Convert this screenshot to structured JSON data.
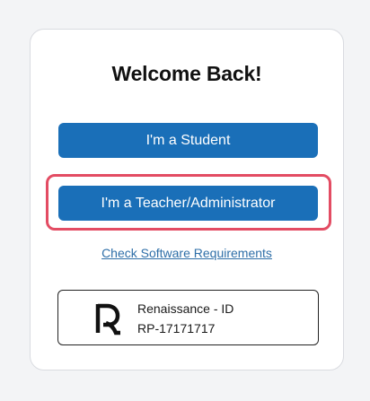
{
  "welcome": {
    "title": "Welcome Back!"
  },
  "buttons": {
    "student_label": "I'm a Student",
    "teacher_label": "I'm a Teacher/Administrator"
  },
  "links": {
    "software_requirements": "Check Software Requirements"
  },
  "renaissance_id": {
    "logo_icon": "renaissance-r-icon",
    "label": "Renaissance - ID",
    "value": "RP-17171717"
  },
  "colors": {
    "primary_button": "#1a6fb8",
    "highlight_border": "#e34c63",
    "link": "#2f6fa8"
  }
}
